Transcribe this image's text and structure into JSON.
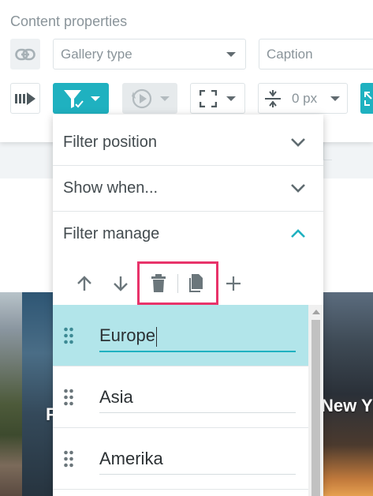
{
  "panel": {
    "title": "Content properties",
    "gallery_type": {
      "placeholder": "Gallery type"
    },
    "caption": {
      "placeholder": "Caption"
    },
    "spacing": {
      "value": "0 px"
    }
  },
  "background": {
    "left_text": "F",
    "right_text": "New Y"
  },
  "dropdown": {
    "sections": [
      {
        "label": "Filter position",
        "expanded": false
      },
      {
        "label": "Show when...",
        "expanded": false
      },
      {
        "label": "Filter manage",
        "expanded": true
      }
    ],
    "toolbar": {
      "actions": [
        "move-up",
        "move-down",
        "delete",
        "duplicate",
        "add"
      ]
    },
    "items": [
      {
        "label": "Europe",
        "selected": true
      },
      {
        "label": "Asia",
        "selected": false
      },
      {
        "label": "Amerika",
        "selected": false
      }
    ]
  },
  "colors": {
    "accent": "#1fb1c0",
    "highlight": "#e8336a",
    "selected_row": "#b2e5ea"
  }
}
